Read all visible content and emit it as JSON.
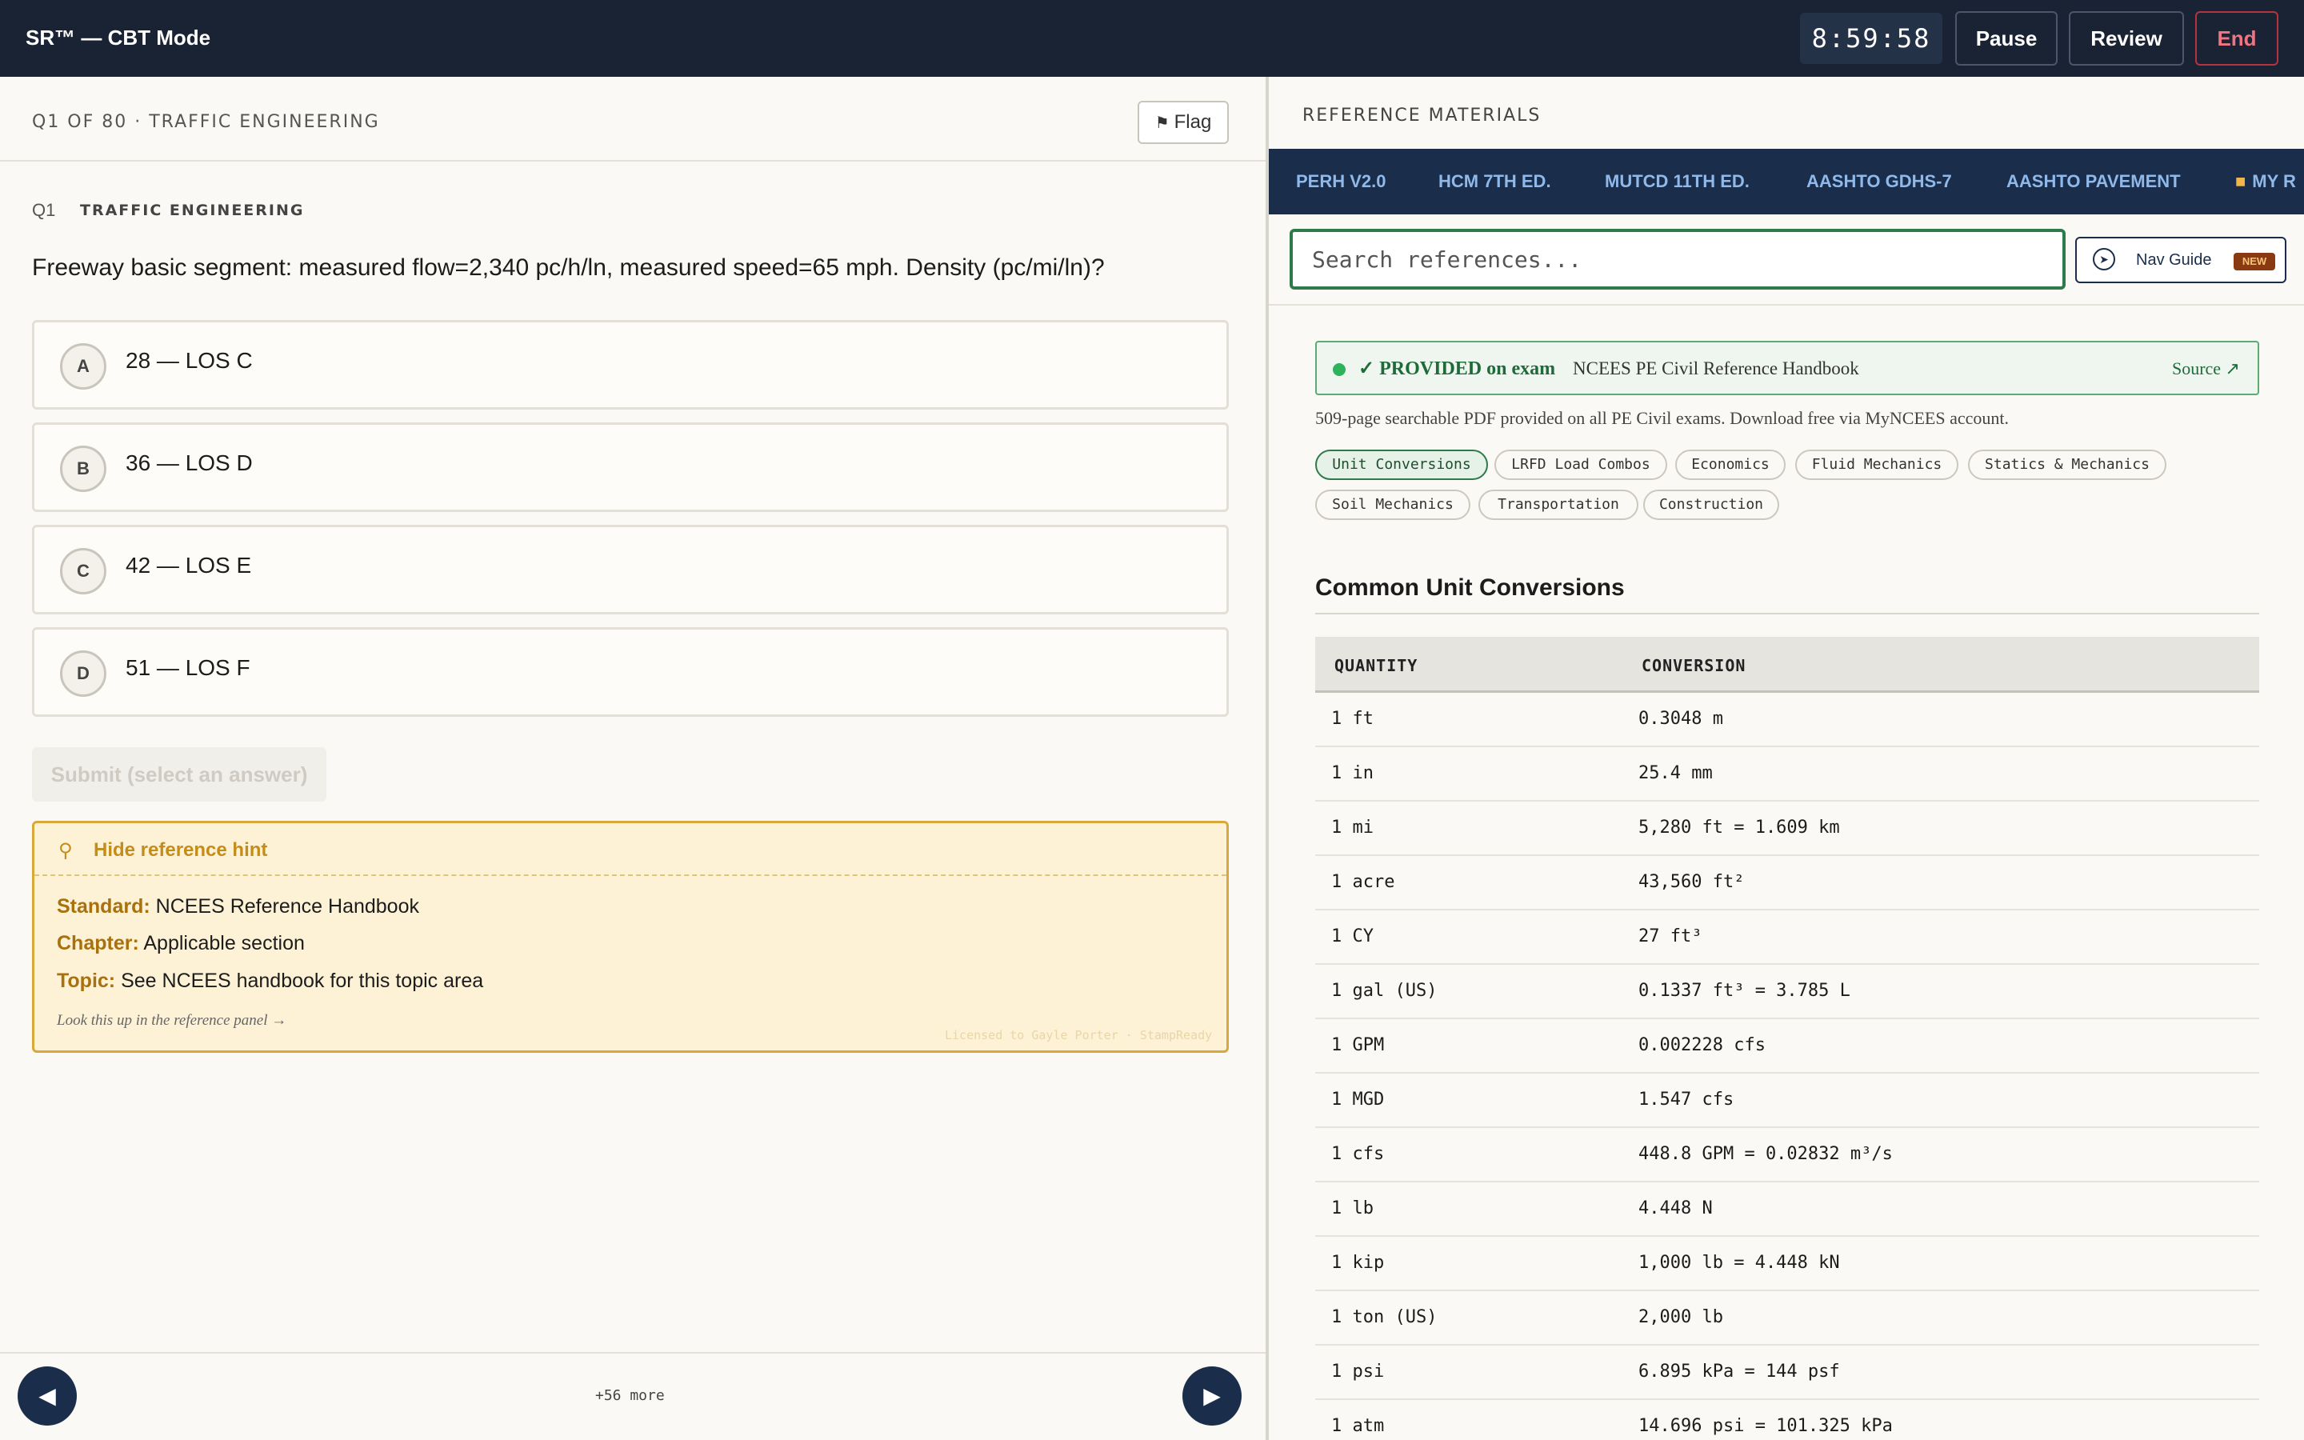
{
  "app": {
    "title": "SR™ — CBT Mode",
    "timer": "8:59:58",
    "pause_label": "Pause",
    "review_label": "Review",
    "end_label": "End"
  },
  "question": {
    "header": "Q1 OF 80 · TRAFFIC ENGINEERING",
    "flag_label": "Flag",
    "number": "Q1",
    "category": "TRAFFIC ENGINEERING",
    "text": "Freeway basic segment: measured flow=2,340 pc/h/ln, measured speed=65 mph. Density (pc/mi/ln)?",
    "choices": [
      {
        "letter": "A",
        "text": "28 — LOS C"
      },
      {
        "letter": "B",
        "text": "36 — LOS D"
      },
      {
        "letter": "C",
        "text": "42 — LOS E"
      },
      {
        "letter": "D",
        "text": "51 — LOS F"
      }
    ],
    "submit_label": "Submit (select an answer)"
  },
  "hint": {
    "toggle_label": "Hide reference hint",
    "standard_label": "Standard:",
    "standard_value": "NCEES Reference Handbook",
    "chapter_label": "Chapter:",
    "chapter_value": "Applicable section",
    "topic_label": "Topic:",
    "topic_value": "See NCEES handbook for this topic area",
    "footer": "Look this up in the reference panel →",
    "watermark": "Licensed to Gayle Porter · StampReady"
  },
  "footer": {
    "prev_icon": "◀",
    "next_icon": "▶",
    "more_label": "+56 more"
  },
  "reference": {
    "title": "REFERENCE MATERIALS",
    "tabs": [
      "PERH V2.0",
      "HCM 7TH ED.",
      "MUTCD 11TH ED.",
      "AASHTO GDHS-7",
      "AASHTO PAVEMENT",
      "MY R"
    ],
    "search_placeholder": "Search references...",
    "nav_guide_label": "Nav Guide",
    "nav_guide_badge": "NEW",
    "provided_tag": "✓ PROVIDED on exam",
    "provided_name": "NCEES PE Civil Reference Handbook",
    "source_label": "Source ↗",
    "description": "509-page searchable PDF provided on all PE Civil exams. Download free via MyNCEES account.",
    "chips": [
      "Unit Conversions",
      "LRFD Load Combos",
      "Economics",
      "Fluid Mechanics",
      "Statics & Mechanics",
      "Soil Mechanics",
      "Transportation",
      "Construction"
    ],
    "active_chip": "Unit Conversions",
    "section_title": "Common Unit Conversions",
    "table_headers": [
      "QUANTITY",
      "CONVERSION"
    ],
    "rows": [
      {
        "q": "1 ft",
        "c": "0.3048 m"
      },
      {
        "q": "1 in",
        "c": "25.4 mm"
      },
      {
        "q": "1 mi",
        "c": "5,280 ft = 1.609 km"
      },
      {
        "q": "1 acre",
        "c": "43,560 ft²"
      },
      {
        "q": "1 CY",
        "c": "27 ft³"
      },
      {
        "q": "1 gal (US)",
        "c": "0.1337 ft³ = 3.785 L"
      },
      {
        "q": "1 GPM",
        "c": "0.002228 cfs"
      },
      {
        "q": "1 MGD",
        "c": "1.547 cfs"
      },
      {
        "q": "1 cfs",
        "c": "448.8 GPM = 0.02832 m³/s"
      },
      {
        "q": "1 lb",
        "c": "4.448 N"
      },
      {
        "q": "1 kip",
        "c": "1,000 lb = 4.448 kN"
      },
      {
        "q": "1 ton (US)",
        "c": "2,000 lb"
      },
      {
        "q": "1 psi",
        "c": "6.895 kPa = 144 psf"
      },
      {
        "q": "1 atm",
        "c": "14.696 psi = 101.325 kPa"
      }
    ]
  }
}
